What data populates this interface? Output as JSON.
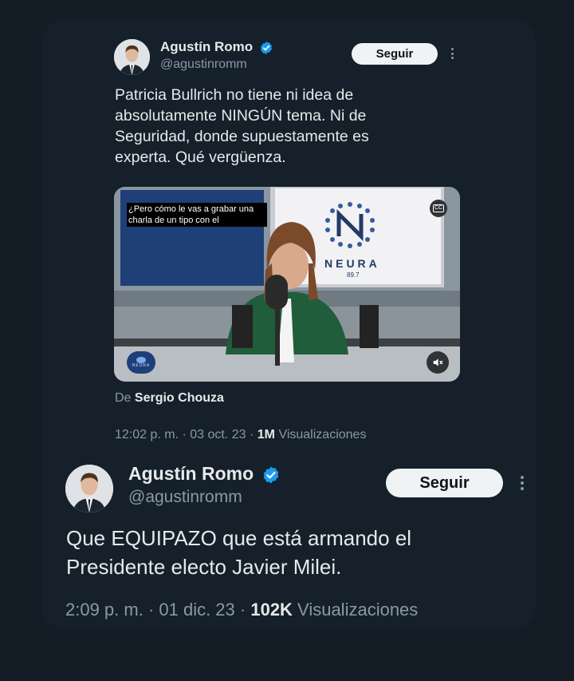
{
  "tweet1": {
    "author_name": "Agustín Romo",
    "author_handle": "@agustinromm",
    "follow_label": "Seguir",
    "text": "Patricia Bullrich no tiene ni idea de\nabsolutamente NINGÚN tema. Ni de\nSeguridad, donde supuestamente es\nexperta. Qué vergüenza.",
    "video": {
      "caption": "¿Pero cómo le vas a grabar una charla de un tipo con el",
      "logo_text": "NEURA",
      "logo_sub": "89.7",
      "cc_label": "CC",
      "corner_logo_text": "NEURA"
    },
    "from_prefix": "De",
    "from_name": "Sergio Chouza",
    "time": "12:02 p. m. · 03 oct. 23 · ",
    "views_count": "1M",
    "views_label": " Visualizaciones"
  },
  "tweet2": {
    "author_name": "Agustín Romo",
    "author_handle": "@agustinromm",
    "follow_label": "Seguir",
    "text": "Que EQUIPAZO que está armando el\nPresidente electo Javier Milei.",
    "time": "2:09 p. m. · 01 dic. 23 · ",
    "views_count": "102K",
    "views_label": " Visualizaciones"
  },
  "colors": {
    "background": "#141d26",
    "card": "#15202b",
    "verified": "#1d9bf0",
    "muted": "#8b98a5",
    "text": "#e7e9ea"
  }
}
